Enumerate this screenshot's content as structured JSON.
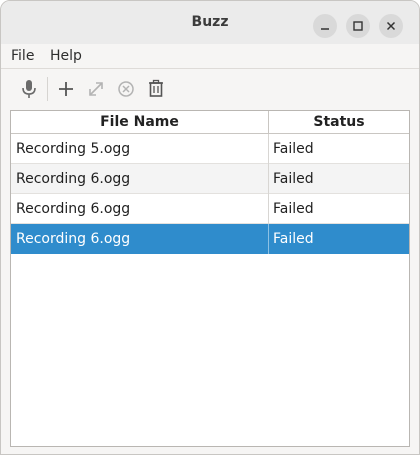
{
  "window": {
    "title": "Buzz",
    "controls": [
      "minimize-icon",
      "maximize-icon",
      "close-icon"
    ]
  },
  "menubar": {
    "items": [
      {
        "label": "File"
      },
      {
        "label": "Help"
      }
    ]
  },
  "toolbar": {
    "buttons": [
      {
        "icon": "microphone-icon",
        "enabled": true
      },
      {
        "icon": "plus-icon",
        "enabled": true
      },
      {
        "icon": "expand-icon",
        "enabled": false
      },
      {
        "icon": "cancel-icon",
        "enabled": false
      },
      {
        "icon": "trash-icon",
        "enabled": true
      }
    ]
  },
  "table": {
    "columns": [
      "File Name",
      "Status"
    ],
    "rows": [
      {
        "file_name": "Recording 5.ogg",
        "status": "Failed",
        "selected": false
      },
      {
        "file_name": "Recording 6.ogg",
        "status": "Failed",
        "selected": false
      },
      {
        "file_name": "Recording 6.ogg",
        "status": "Failed",
        "selected": false
      },
      {
        "file_name": "Recording 6.ogg",
        "status": "Failed",
        "selected": true
      }
    ]
  },
  "colors": {
    "selection": "#2f8ccc",
    "titlebar": "#ebebeb",
    "window_bg": "#f6f5f4"
  }
}
